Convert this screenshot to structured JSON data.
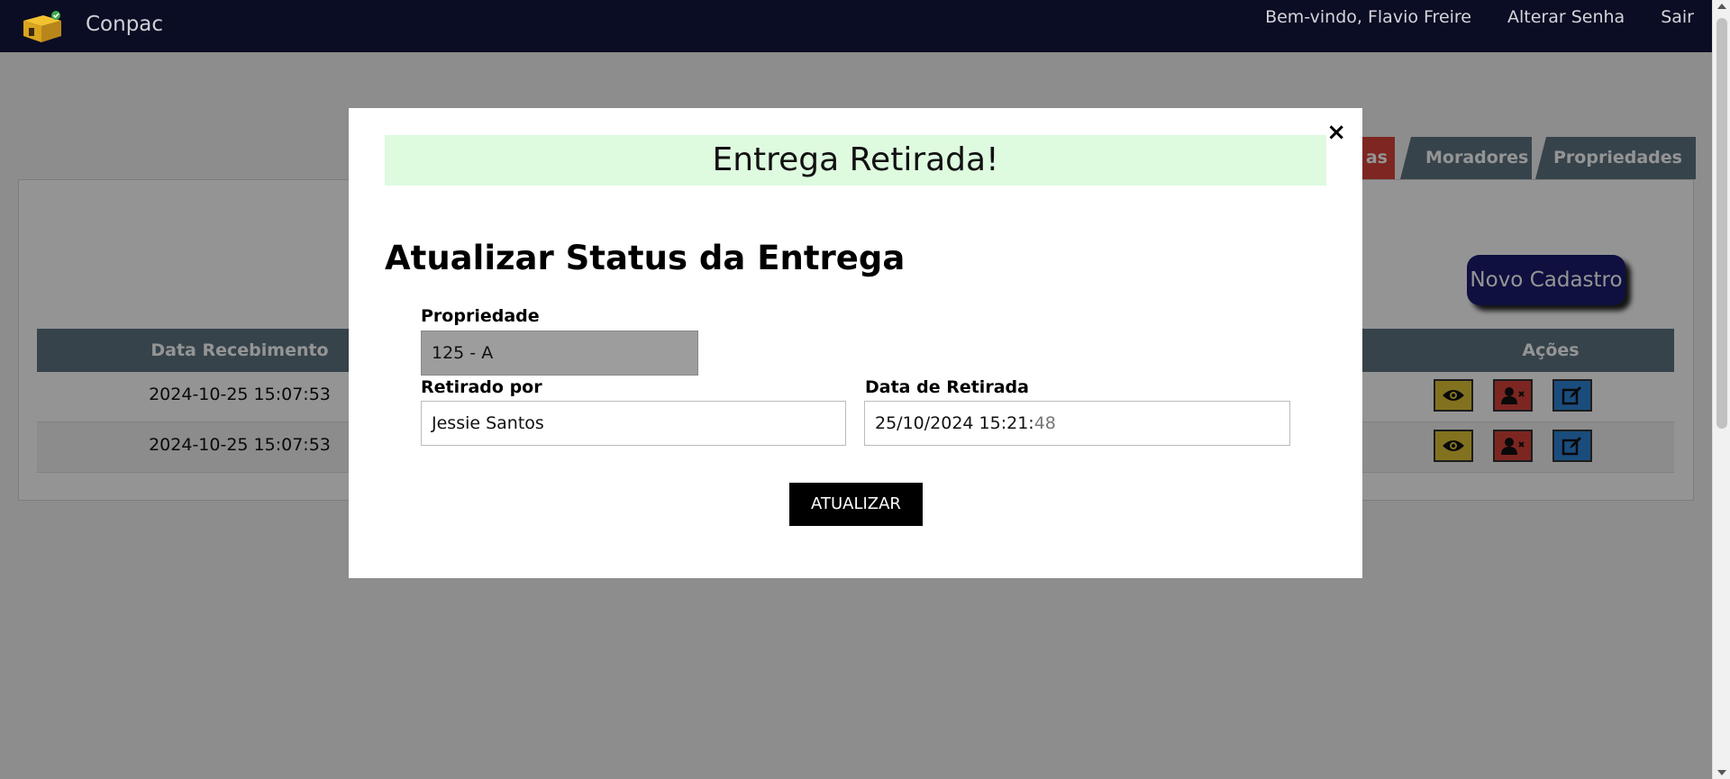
{
  "navbar": {
    "brand": "Conpac",
    "logo_icon": "package-box-icon",
    "links": [
      {
        "label": "Bem-vindo, Flavio Freire"
      },
      {
        "label": "Alterar Senha"
      },
      {
        "label": "Sair"
      }
    ]
  },
  "tabs": [
    {
      "label": "as"
    },
    {
      "label": "Moradores"
    },
    {
      "label": "Propriedades"
    }
  ],
  "main": {
    "new_button": "Novo Cadastro",
    "table": {
      "headers": {
        "data": "Data Recebimento",
        "acoes": "Ações"
      },
      "rows": [
        {
          "data": "2024-10-25 15:07:53"
        },
        {
          "data": "2024-10-25 15:07:53"
        }
      ]
    }
  },
  "modal": {
    "close": "×",
    "alert": "Entrega Retirada!",
    "title": "Atualizar Status da Entrega",
    "propriedade_label": "Propriedade",
    "propriedade_value": "125 - A",
    "retirado_label": "Retirado por",
    "retirado_value": "Jessie Santos",
    "data_label": "Data de Retirada",
    "data_value": "25/10/2024 15:21:",
    "data_seconds": "48",
    "submit": "ATUALIZAR"
  },
  "colors": {
    "navbar": "#0b0d24",
    "tab_active": "#d9433a",
    "tab": "#5e7481",
    "alert_bg": "#defadf",
    "new_button": "#1b1d6e"
  }
}
